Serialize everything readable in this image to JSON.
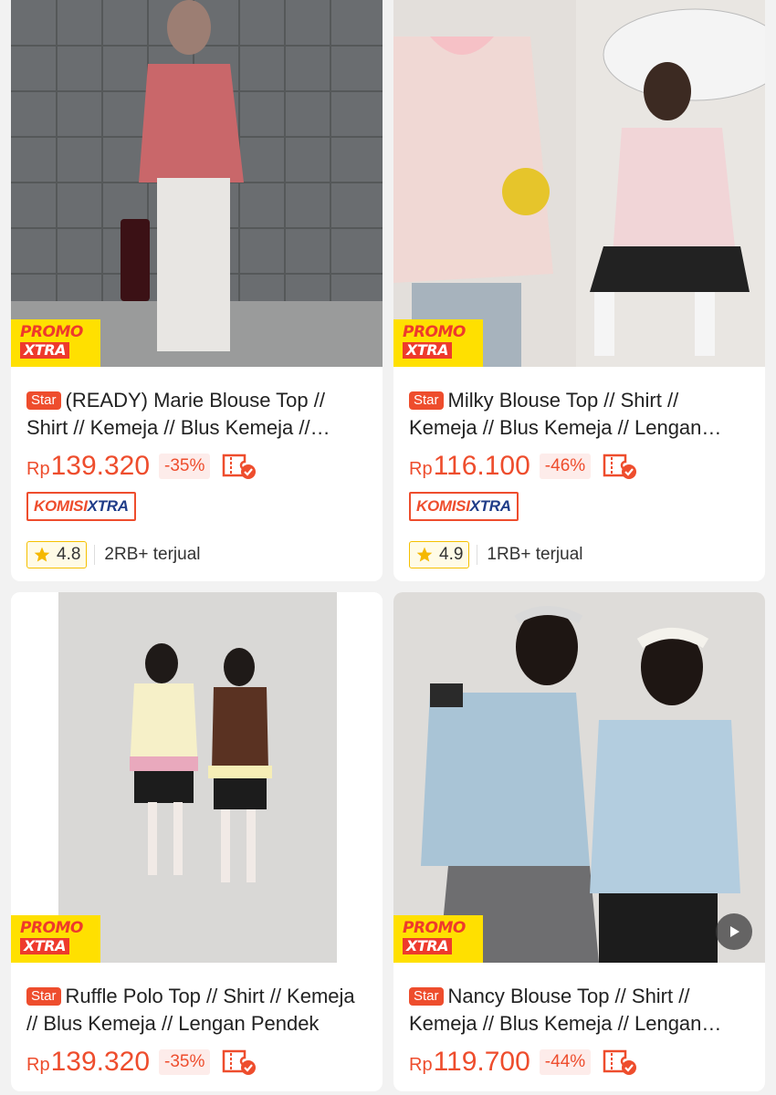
{
  "products": [
    {
      "badge": "Star",
      "title": "(READY) Marie Blouse Top // Shirt // Kemeja // Blus Kemeja // Lengan Panjang",
      "currency": "Rp",
      "price": "139.320",
      "discount": "-35%",
      "promo_line1": "PROMO",
      "promo_line2": "XTRA",
      "komisi_part1": "KOMISI",
      "komisi_part2": "XTRA",
      "rating": "4.8",
      "sold": "2RB+ terjual"
    },
    {
      "badge": "Star",
      "title": "Milky Blouse Top // Shirt // Kemeja // Blus Kemeja // Lengan Pendek",
      "currency": "Rp",
      "price": "116.100",
      "discount": "-46%",
      "promo_line1": "PROMO",
      "promo_line2": "XTRA",
      "komisi_part1": "KOMISI",
      "komisi_part2": "XTRA",
      "rating": "4.9",
      "sold": "1RB+ terjual"
    },
    {
      "badge": "Star",
      "title": "Ruffle Polo Top // Shirt // Kemeja // Blus Kemeja // Lengan Pendek",
      "currency": "Rp",
      "price": "139.320",
      "discount": "-35%",
      "promo_line1": "PROMO",
      "promo_line2": "XTRA"
    },
    {
      "badge": "Star",
      "title": "Nancy Blouse Top // Shirt // Kemeja // Blus Kemeja // Lengan Panjang",
      "currency": "Rp",
      "price": "119.700",
      "discount": "-44%",
      "promo_line1": "PROMO",
      "promo_line2": "XTRA"
    }
  ],
  "colors": {
    "accent": "#ee4d2d",
    "promo_yellow": "#ffe000",
    "komisi_blue": "#1f3c88",
    "rating_star": "#f5b800"
  },
  "icons": [
    "star-icon",
    "free-shipping-voucher-icon",
    "play-icon"
  ]
}
